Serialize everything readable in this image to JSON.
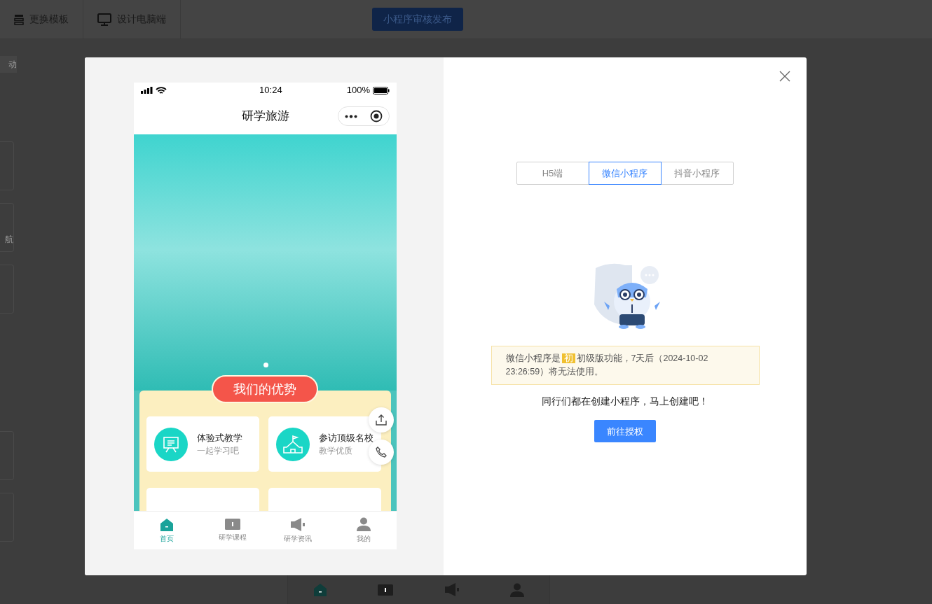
{
  "app": {
    "toolbar": [
      {
        "label": "更换模板",
        "kind": "template"
      },
      {
        "label": "设计电脑端",
        "kind": "desktop"
      }
    ],
    "publish_button": "小程序审核发布",
    "side_fragments": [
      "动",
      "航"
    ]
  },
  "dialog": {
    "preview": {
      "status_bar": {
        "time": "10:24",
        "battery": "100%"
      },
      "title": "研学旅游",
      "section_title": "我们的优势",
      "features": [
        {
          "title": "体验式教学",
          "subtitle": "一起学习吧",
          "kind": "board"
        },
        {
          "title": "参访顶级名校",
          "subtitle": "教学优质",
          "kind": "school"
        }
      ],
      "tab_bar": [
        {
          "label": "首页",
          "kind": "home",
          "selected": true
        },
        {
          "label": "研学课程",
          "kind": "book",
          "selected": false
        },
        {
          "label": "研学资讯",
          "kind": "megaphone",
          "selected": false
        },
        {
          "label": "我的",
          "kind": "person",
          "selected": false
        }
      ]
    },
    "platform_tabs": [
      {
        "label": "H5端",
        "selected": false
      },
      {
        "label": "微信小程序",
        "selected": true
      },
      {
        "label": "抖音小程序",
        "selected": false
      }
    ],
    "notice": {
      "text_before": "微信小程序是",
      "badge": "初",
      "text_after": "初级版功能，7天后（2024-10-02 23:26:59）将无法使用。"
    },
    "prompt": "同行们都在创建小程序，马上创建吧！",
    "action_button": "前往授权"
  }
}
